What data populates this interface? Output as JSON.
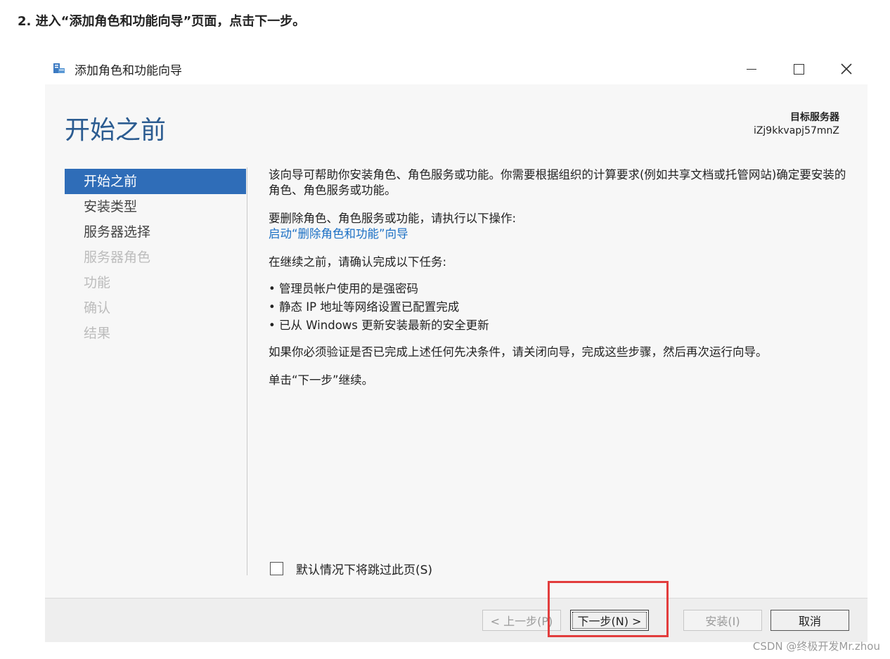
{
  "step_heading": "2. 进入“添加角色和功能向导”页面，点击下一步。",
  "window": {
    "title": "添加角色和功能向导",
    "icon": "server-wizard-icon",
    "controls": {
      "minimize": "—",
      "maximize": "☐",
      "close": "✕"
    }
  },
  "header": {
    "page_title": "开始之前",
    "target_server_label": "目标服务器",
    "target_server_name": "iZj9kkvapj57mnZ"
  },
  "nav": {
    "items": [
      {
        "label": "开始之前",
        "state": "active"
      },
      {
        "label": "安装类型",
        "state": "enabled"
      },
      {
        "label": "服务器选择",
        "state": "enabled"
      },
      {
        "label": "服务器角色",
        "state": "disabled"
      },
      {
        "label": "功能",
        "state": "disabled"
      },
      {
        "label": "确认",
        "state": "disabled"
      },
      {
        "label": "结果",
        "state": "disabled"
      }
    ]
  },
  "body": {
    "intro": "该向导可帮助你安装角色、角色服务或功能。你需要根据组织的计算要求(例如共享文档或托管网站)确定要安装的角色、角色服务或功能。",
    "remove_text": "要删除角色、角色服务或功能，请执行以下操作:",
    "remove_link": "启动“删除角色和功能”向导",
    "confirm_text": "在继续之前，请确认完成以下任务:",
    "bullets": [
      "管理员帐户使用的是强密码",
      "静态 IP 地址等网络设置已配置完成",
      "已从 Windows 更新安装最新的安全更新"
    ],
    "verify_text": "如果你必须验证是否已完成上述任何先决条件，请关闭向导，完成这些步骤，然后再次运行向导。",
    "continue_text": "单击“下一步”继续。",
    "skip_checkbox_label": "默认情况下将跳过此页(S)",
    "skip_checkbox_checked": false
  },
  "footer": {
    "prev_label": "< 上一步(P)",
    "next_label": "下一步(N) >",
    "install_label": "安装(I)",
    "cancel_label": "取消"
  },
  "annotation_color": "#e23d3d",
  "watermark": "CSDN @终极开发Mr.zhou"
}
